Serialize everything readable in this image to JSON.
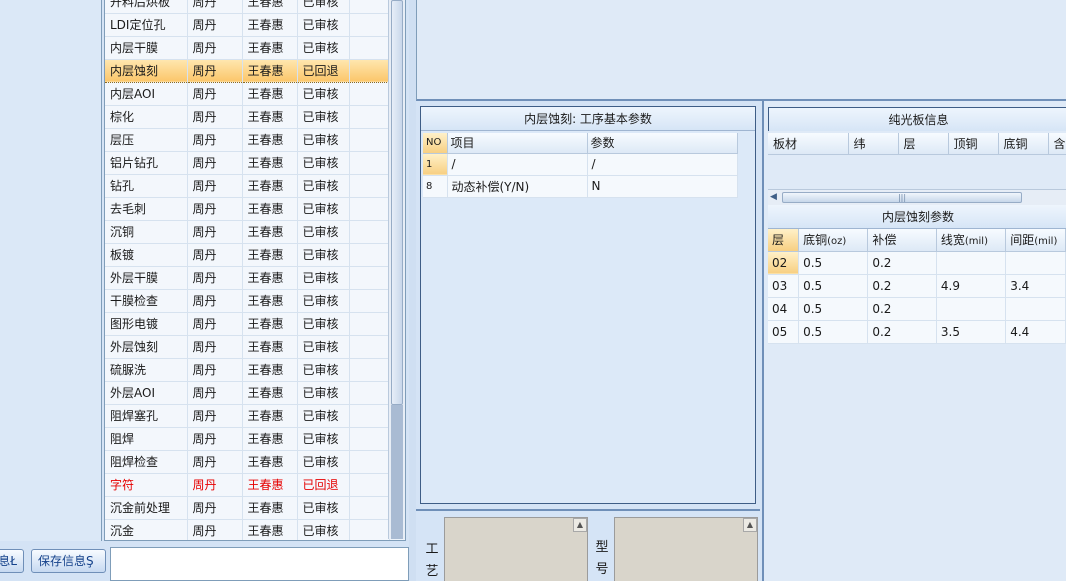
{
  "process_list": {
    "rows": [
      {
        "name": "开料后烘板",
        "a": "周丹",
        "b": "王春惠",
        "status": "已审核"
      },
      {
        "name": "LDI定位孔",
        "a": "周丹",
        "b": "王春惠",
        "status": "已审核"
      },
      {
        "name": "内层干膜",
        "a": "周丹",
        "b": "王春惠",
        "status": "已审核"
      },
      {
        "name": "内层蚀刻",
        "a": "周丹",
        "b": "王春惠",
        "status": "已回退"
      },
      {
        "name": "内层AOI",
        "a": "周丹",
        "b": "王春惠",
        "status": "已审核"
      },
      {
        "name": "棕化",
        "a": "周丹",
        "b": "王春惠",
        "status": "已审核"
      },
      {
        "name": "层压",
        "a": "周丹",
        "b": "王春惠",
        "status": "已审核"
      },
      {
        "name": "铝片钻孔",
        "a": "周丹",
        "b": "王春惠",
        "status": "已审核"
      },
      {
        "name": "钻孔",
        "a": "周丹",
        "b": "王春惠",
        "status": "已审核"
      },
      {
        "name": "去毛刺",
        "a": "周丹",
        "b": "王春惠",
        "status": "已审核"
      },
      {
        "name": "沉铜",
        "a": "周丹",
        "b": "王春惠",
        "status": "已审核"
      },
      {
        "name": "板镀",
        "a": "周丹",
        "b": "王春惠",
        "status": "已审核"
      },
      {
        "name": "外层干膜",
        "a": "周丹",
        "b": "王春惠",
        "status": "已审核"
      },
      {
        "name": "干膜检查",
        "a": "周丹",
        "b": "王春惠",
        "status": "已审核"
      },
      {
        "name": "图形电镀",
        "a": "周丹",
        "b": "王春惠",
        "status": "已审核"
      },
      {
        "name": "外层蚀刻",
        "a": "周丹",
        "b": "王春惠",
        "status": "已审核"
      },
      {
        "name": "硫脲洗",
        "a": "周丹",
        "b": "王春惠",
        "status": "已审核"
      },
      {
        "name": "外层AOI",
        "a": "周丹",
        "b": "王春惠",
        "status": "已审核"
      },
      {
        "name": "阻焊塞孔",
        "a": "周丹",
        "b": "王春惠",
        "status": "已审核"
      },
      {
        "name": "阻焊",
        "a": "周丹",
        "b": "王春惠",
        "status": "已审核"
      },
      {
        "name": "阻焊检查",
        "a": "周丹",
        "b": "王春惠",
        "status": "已审核"
      },
      {
        "name": "字符",
        "a": "周丹",
        "b": "王春惠",
        "status": "已回退"
      },
      {
        "name": "沉金前处理",
        "a": "周丹",
        "b": "王春惠",
        "status": "已审核"
      },
      {
        "name": "沉金",
        "a": "周丹",
        "b": "王春惠",
        "status": "已审核"
      }
    ],
    "selected_index": 3,
    "red_index": 21
  },
  "buttons": {
    "info_label": "息Ł",
    "save_label": "保存信息Ş"
  },
  "params_panel": {
    "title": "内层蚀刻: 工序基本参数",
    "headers": {
      "no": "NO",
      "item": "项目",
      "param": "参数"
    },
    "rows": [
      {
        "no": "1",
        "item": "/",
        "param": "/"
      },
      {
        "no": "8",
        "item": "动态补偿(Y/N)",
        "param": "N"
      }
    ]
  },
  "memo_labels": {
    "craft": "工艺",
    "model": "型号"
  },
  "pure_board": {
    "title": "纯光板信息",
    "columns": [
      "板材",
      "纬",
      "层",
      "顶铜",
      "底铜",
      "含"
    ]
  },
  "etch_params": {
    "title": "内层蚀刻参数",
    "headers": {
      "layer": "层",
      "bottom_cu": "底铜",
      "bottom_cu_unit": "(oz)",
      "comp": "补偿",
      "line_w": "线宽",
      "line_w_unit": "(mil)",
      "spacing": "间距",
      "spacing_unit": "(mil)"
    },
    "rows": [
      {
        "layer": "02",
        "bottom_cu": "0.5",
        "comp": "0.2",
        "line_w": "",
        "spacing": ""
      },
      {
        "layer": "03",
        "bottom_cu": "0.5",
        "comp": "0.2",
        "line_w": "4.9",
        "spacing": "3.4"
      },
      {
        "layer": "04",
        "bottom_cu": "0.5",
        "comp": "0.2",
        "line_w": "",
        "spacing": ""
      },
      {
        "layer": "05",
        "bottom_cu": "0.5",
        "comp": "0.2",
        "line_w": "3.5",
        "spacing": "4.4"
      }
    ]
  },
  "colors": {
    "selected_row": "#fbc66b",
    "returned_text": "#e60000",
    "panel_border": "#3e5d86"
  }
}
